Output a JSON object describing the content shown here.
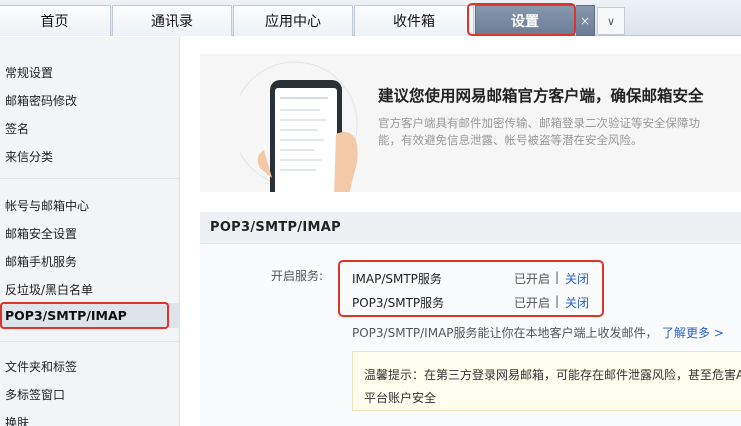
{
  "tabs": [
    {
      "label": "首页"
    },
    {
      "label": "通讯录"
    },
    {
      "label": "应用中心"
    },
    {
      "label": "收件箱"
    },
    {
      "label": "设置",
      "active": true
    }
  ],
  "tab_close_glyph": "×",
  "tab_more_glyph": "∨",
  "sidebar": {
    "items": [
      {
        "label": "常规设置"
      },
      {
        "label": "邮箱密码修改"
      },
      {
        "label": "签名"
      },
      {
        "label": "来信分类"
      },
      {
        "label": "帐号与邮箱中心"
      },
      {
        "label": "邮箱安全设置"
      },
      {
        "label": "邮箱手机服务"
      },
      {
        "label": "反垃圾/黑白名单"
      },
      {
        "label": "POP3/SMTP/IMAP",
        "active": true
      },
      {
        "label": "文件夹和标签"
      },
      {
        "label": "多标签窗口"
      },
      {
        "label": "换肤"
      }
    ]
  },
  "banner": {
    "title": "建议您使用网易邮箱官方客户端，确保邮箱安全",
    "desc": "官方客户端具有邮件加密传输、邮箱登录二次验证等安全保障功能，有效避免信息泄露、帐号被盗等潜在安全风险。"
  },
  "section": {
    "title": "POP3/SMTP/IMAP",
    "open_label": "开启服务:",
    "services": [
      {
        "name": "IMAP/SMTP服务",
        "status": "已开启",
        "sep": "|",
        "action": "关闭"
      },
      {
        "name": "POP3/SMTP服务",
        "status": "已开启",
        "sep": "|",
        "action": "关闭"
      }
    ],
    "info": "POP3/SMTP/IMAP服务能让你在本地客户端上收发邮件，",
    "info_link": "了解更多 >",
    "tip_line1": "温馨提示：在第三方登录网易邮箱，可能存在邮件泄露风险，甚至危害Ap",
    "tip_line2": "平台账户安全"
  },
  "colors": {
    "highlight": "#e0332a",
    "link": "#2a62c9",
    "active_tab": "#7687a0"
  }
}
